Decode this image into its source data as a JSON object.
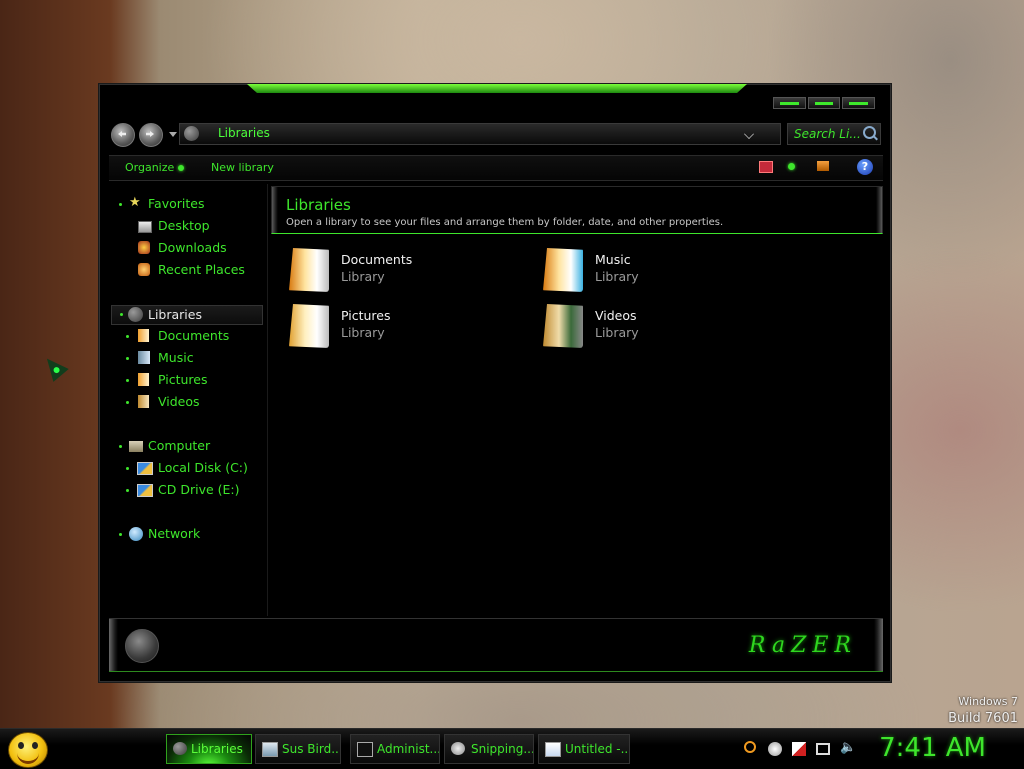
{
  "window": {
    "address": {
      "text": "Libraries"
    },
    "search": {
      "placeholder": "Search Li..."
    },
    "toolbar": {
      "organize": "Organize",
      "new_library": "New library"
    },
    "sidebar": {
      "favorites": {
        "label": "Favorites",
        "items": [
          "Desktop",
          "Downloads",
          "Recent Places"
        ]
      },
      "libraries": {
        "label": "Libraries",
        "items": [
          "Documents",
          "Music",
          "Pictures",
          "Videos"
        ]
      },
      "computer": {
        "label": "Computer",
        "items": [
          "Local Disk (C:)",
          "CD Drive (E:)"
        ]
      },
      "network": {
        "label": "Network"
      }
    },
    "content": {
      "title": "Libraries",
      "subtitle": "Open a library to see your files and arrange them by folder, date, and other properties.",
      "libraries": [
        {
          "name": "Documents",
          "type": "Library"
        },
        {
          "name": "Music",
          "type": "Library"
        },
        {
          "name": "Pictures",
          "type": "Library"
        },
        {
          "name": "Videos",
          "type": "Library"
        }
      ]
    },
    "brand": "RaZER"
  },
  "watermark": {
    "os": "Windows 7",
    "build": "Build 7601"
  },
  "taskbar": {
    "tasks": [
      "Libraries",
      "Sus Bird...",
      "Administ...",
      "Snipping...",
      "Untitled -..."
    ],
    "clock": "7:41 AM"
  },
  "colors": {
    "accent": "#3ee62c",
    "background": "#000000"
  }
}
